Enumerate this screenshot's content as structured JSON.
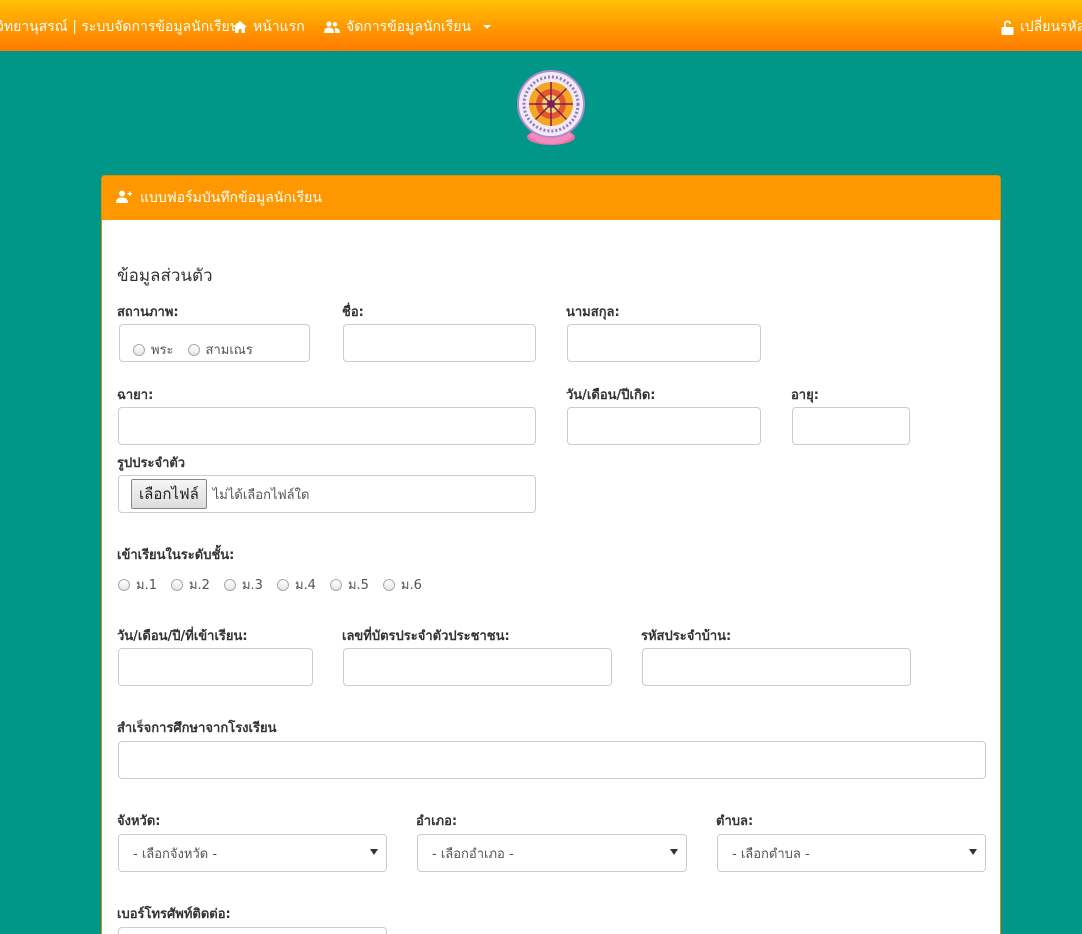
{
  "navbar": {
    "brand": "วิทยานุสรณ์ | ระบบจัดการข้อมูลนักเรียน",
    "home": "หน้าแรก",
    "students": "จัดการข้อมูลนักเรียน",
    "password": "เปลี่ยนรหัสผ"
  },
  "panel": {
    "heading": "แบบฟอร์มบันทึกข้อมูลนักเรียน",
    "section_title": "ข้อมูลส่วนตัว"
  },
  "form": {
    "status_label": "สถานภาพ:",
    "status_options": [
      "พระ",
      "สามเณร"
    ],
    "firstname_label": "ชื่อ:",
    "lastname_label": "นามสกุล:",
    "alias_label": "ฉายา:",
    "birthdate_label": "วัน/เดือน/ปีเกิด:",
    "age_label": "อายุ:",
    "photo_label": "รูปประจำตัว",
    "file_button": "เลือกไฟล์",
    "file_status": "ไม่ได้เลือกไฟล์ใด",
    "grade_label": "เข้าเรียนในระดับชั้น:",
    "grade_options": [
      "ม.1",
      "ม.2",
      "ม.3",
      "ม.4",
      "ม.5",
      "ม.6"
    ],
    "entry_date_label": "วัน/เดือน/ปี/ที่เข้าเรียน:",
    "id_card_label": "เลขที่บัตรประจำตัวประชาชน:",
    "house_code_label": "รหัสประจำบ้าน:",
    "graduated_label": "สำเร็จการศึกษาจากโรงเรียน",
    "province_label": "จังหวัด:",
    "province_select": "- เลือกจังหวัด -",
    "district_label": "อำเภอ:",
    "district_select": "- เลือกอำเภอ -",
    "subdistrict_label": "ตำบล:",
    "subdistrict_select": "- เลือกตำบล -",
    "phone_label": "เบอร์โทรศัพท์ติดต่อ:"
  },
  "colors": {
    "background": "#009688",
    "navbar_top": "#ffc107",
    "navbar_bottom": "#ff7a00",
    "panel_heading": "#ff9800"
  }
}
